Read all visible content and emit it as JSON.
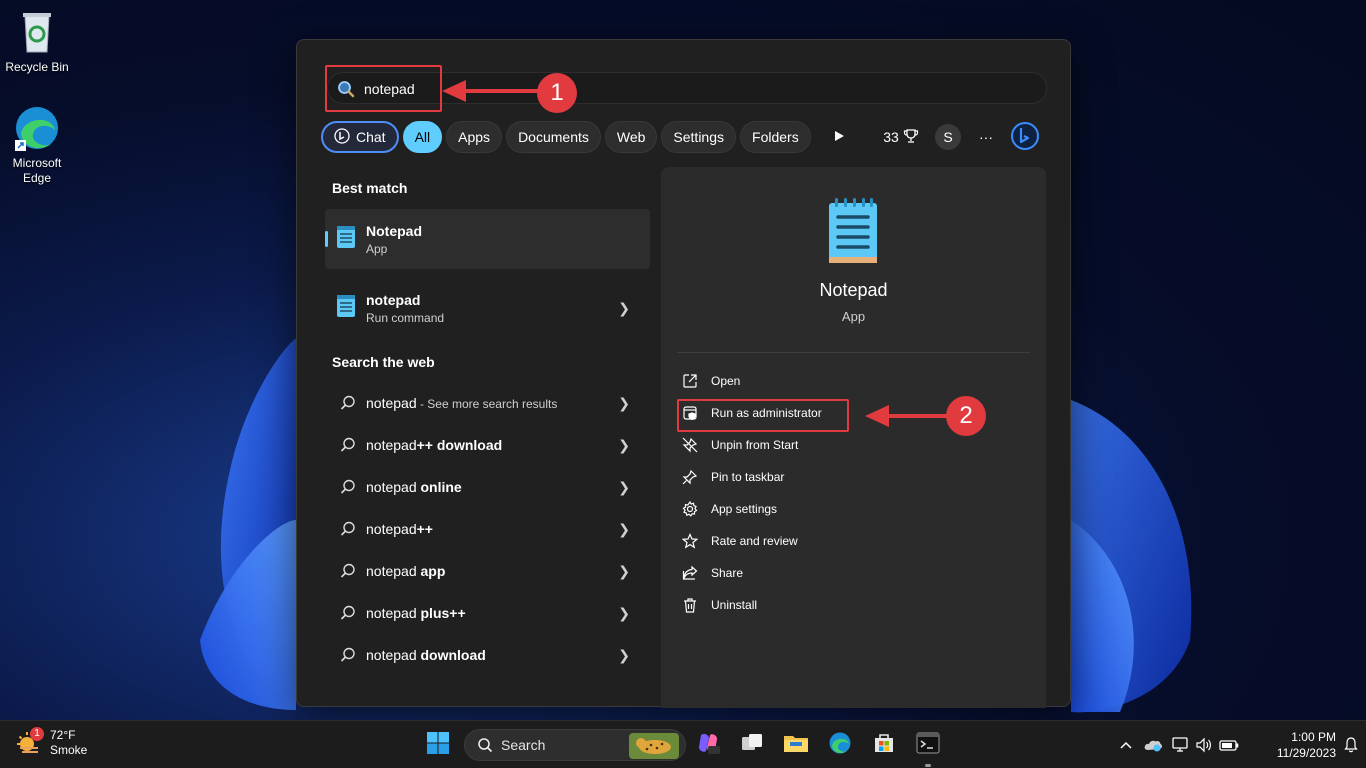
{
  "desktop": {
    "icons": [
      {
        "label": "Recycle Bin"
      },
      {
        "label": "Microsoft Edge"
      }
    ]
  },
  "search": {
    "query": "notepad",
    "step1": "1",
    "step2": "2"
  },
  "filters": {
    "chat": "Chat",
    "items": [
      "All",
      "Apps",
      "Documents",
      "Web",
      "Settings",
      "Folders"
    ],
    "active": "All",
    "points": "33",
    "avatar": "S",
    "more": "···"
  },
  "left": {
    "best_match_title": "Best match",
    "best_match": {
      "name": "Notepad",
      "type": "App"
    },
    "run_command": {
      "name": "notepad",
      "type": "Run command"
    },
    "web_title": "Search the web",
    "web_results": [
      {
        "base": "notepad",
        "bold": "",
        "sub": " - See more search results"
      },
      {
        "base": "notepad",
        "bold": "++ download",
        "sub": ""
      },
      {
        "base": "notepad",
        "bold": " online",
        "sub": ""
      },
      {
        "base": "notepad",
        "bold": "++",
        "sub": ""
      },
      {
        "base": "notepad",
        "bold": " app",
        "sub": ""
      },
      {
        "base": "notepad",
        "bold": " plus++",
        "sub": ""
      },
      {
        "base": "notepad",
        "bold": " download",
        "sub": ""
      }
    ]
  },
  "preview": {
    "name": "Notepad",
    "type": "App",
    "actions": [
      {
        "label": "Open",
        "icon": "open-icon"
      },
      {
        "label": "Run as administrator",
        "icon": "shield-admin-icon"
      },
      {
        "label": "Unpin from Start",
        "icon": "unpin-icon"
      },
      {
        "label": "Pin to taskbar",
        "icon": "pin-icon"
      },
      {
        "label": "App settings",
        "icon": "gear-icon"
      },
      {
        "label": "Rate and review",
        "icon": "star-icon"
      },
      {
        "label": "Share",
        "icon": "share-icon"
      },
      {
        "label": "Uninstall",
        "icon": "trash-icon"
      }
    ]
  },
  "taskbar": {
    "weather_temp": "72°F",
    "weather_desc": "Smoke",
    "weather_badge": "1",
    "search_label": "Search",
    "time": "1:00 PM",
    "date": "11/29/2023"
  },
  "colors": {
    "accent": "#60cdff",
    "annotation": "#e13b40",
    "panel": "#202020"
  }
}
